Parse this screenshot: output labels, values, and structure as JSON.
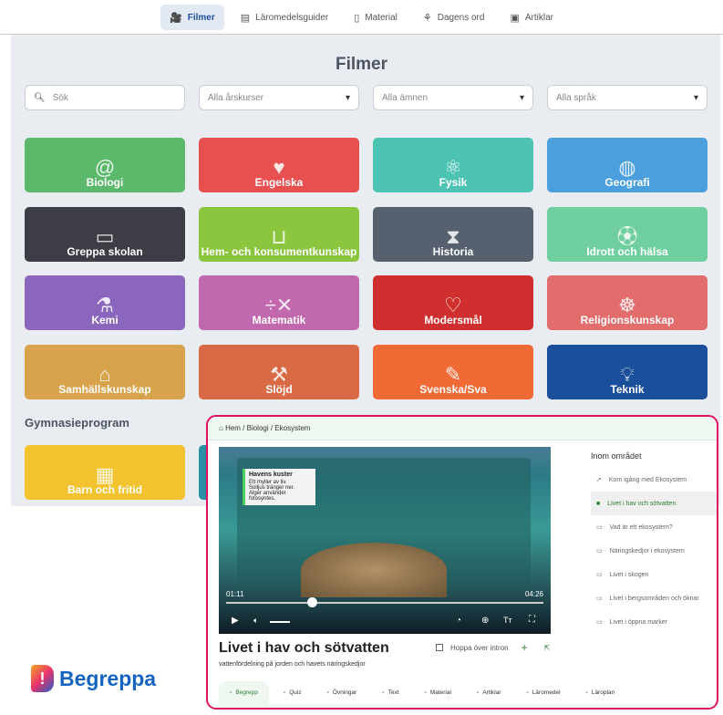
{
  "nav": [
    {
      "label": "Filmer",
      "icon": "video-camera-icon",
      "active": true
    },
    {
      "label": "Läromedelsguider",
      "icon": "book-icon"
    },
    {
      "label": "Material",
      "icon": "document-icon"
    },
    {
      "label": "Dagens ord",
      "icon": "sprout-icon"
    },
    {
      "label": "Artiklar",
      "icon": "article-icon"
    }
  ],
  "page_title": "Filmer",
  "filters": {
    "search_placeholder": "Sök",
    "grades": "Alla årskurser",
    "subjects": "Alla ämnen",
    "languages": "Alla språk"
  },
  "subjects": [
    {
      "label": "Biologi",
      "color": "#5cb96b",
      "icon": "snail-icon"
    },
    {
      "label": "Engelska",
      "color": "#e85050",
      "icon": "heart-flag-icon"
    },
    {
      "label": "Fysik",
      "color": "#4dc4b3",
      "icon": "atom-icon"
    },
    {
      "label": "Geografi",
      "color": "#4b9fdc",
      "icon": "globe-icon"
    },
    {
      "label": "Greppa skolan",
      "color": "#3d3d45",
      "icon": "books-icon"
    },
    {
      "label": "Hem- och konsumentkunskap",
      "color": "#8cc63f",
      "icon": "pot-icon"
    },
    {
      "label": "Historia",
      "color": "#56606e",
      "icon": "hourglass-icon"
    },
    {
      "label": "Idrott och hälsa",
      "color": "#6fcf9f",
      "icon": "ball-icon"
    },
    {
      "label": "Kemi",
      "color": "#8a66bd",
      "icon": "flask-icon"
    },
    {
      "label": "Matematik",
      "color": "#c268ae",
      "icon": "math-symbols-icon"
    },
    {
      "label": "Modersmål",
      "color": "#d02f2f",
      "icon": "heart-icon"
    },
    {
      "label": "Religionskunskap",
      "color": "#e36c6c",
      "icon": "hands-icon"
    },
    {
      "label": "Samhällskunskap",
      "color": "#d8a34a",
      "icon": "buildings-icon"
    },
    {
      "label": "Slöjd",
      "color": "#d96a45",
      "icon": "saw-icon"
    },
    {
      "label": "Svenska/Sva",
      "color": "#f06a35",
      "icon": "pencil-icon"
    },
    {
      "label": "Teknik",
      "color": "#1a4f9c",
      "icon": "lightbulb-icon"
    }
  ],
  "gym_heading": "Gymnasieprogram",
  "gym": [
    {
      "label": "Barn och fritid",
      "color": "#f2c32e"
    }
  ],
  "player": {
    "breadcrumb": "Hem / Biologi / Ekosystem",
    "slide_title": "Havens kuster",
    "slide_bullets": [
      "Ett myller av liv.",
      "Solljus tränger ner.",
      "Alger använder fotosyntes."
    ],
    "time_current": "01:11",
    "time_total": "04:26",
    "progress": 0.27,
    "title": "Livet i hav och sötvatten",
    "subtitle": "vattenfördelning på jorden och havets näringskedjor",
    "skip_intro": "Hoppa över intron",
    "sidebar_heading": "Inom området",
    "sidebar": [
      "Kom igång med Ekosystem",
      "Livet i hav och sötvatten",
      "Vad är ett ekosystem?",
      "Näringskedjor i ekosystem",
      "Livet i skogen",
      "Livet i bergsområden och öknar",
      "Livet i öppna marker"
    ],
    "tabs": [
      "Begrepp",
      "Quiz",
      "Övningar",
      "Text",
      "Material",
      "Artiklar",
      "Läromedel",
      "Läroplan"
    ]
  },
  "logo": "Begreppa"
}
